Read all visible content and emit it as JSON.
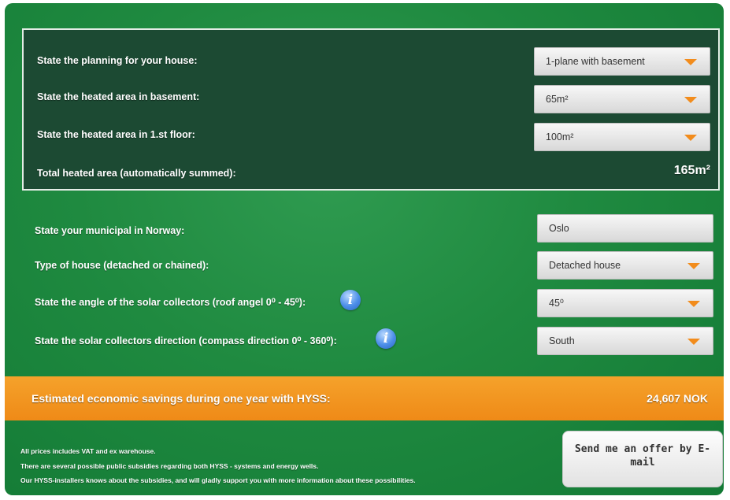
{
  "planning": {
    "planning_label": "State the planning for your house:",
    "planning_value": "1-plane with basement",
    "basement_label": "State the heated area in basement:",
    "basement_value": "65m²",
    "first_floor_label": "State the heated area in 1.st floor:",
    "first_floor_value": "100m²",
    "total_label": "Total heated area (automatically summed):",
    "total_value": "165m²"
  },
  "location": {
    "municipal_label": "State your municipal in Norway:",
    "municipal_value": "Oslo",
    "house_type_label": "Type of house (detached or chained):",
    "house_type_value": "Detached house",
    "angle_label": "State the angle of the solar collectors (roof angel 0⁰ - 45⁰):",
    "angle_value": "45⁰",
    "direction_label": "State the solar collectors direction (compass direction 0⁰ - 360⁰):",
    "direction_value": "South",
    "info_glyph": "i"
  },
  "savings": {
    "label": "Estimated economic savings during one year with HYSS:",
    "value": "24,607 NOK"
  },
  "footer": {
    "note1": "All prices includes VAT and ex warehouse.",
    "note2": "There are several possible public subsidies regarding both HYSS - systems and energy wells.",
    "note3": "Our HYSS-installers knows about the subsidies, and will gladly support you with more information about these possibilities.",
    "offer_button": "Send me an offer by E-mail"
  },
  "colors": {
    "panel_green": "#1f8a40",
    "box_dark_green": "#1c4a33",
    "accent_orange": "#ef8a17",
    "info_blue": "#4c8ee8"
  },
  "icons": {
    "dropdown": "chevron-down-icon",
    "info": "info-icon"
  }
}
